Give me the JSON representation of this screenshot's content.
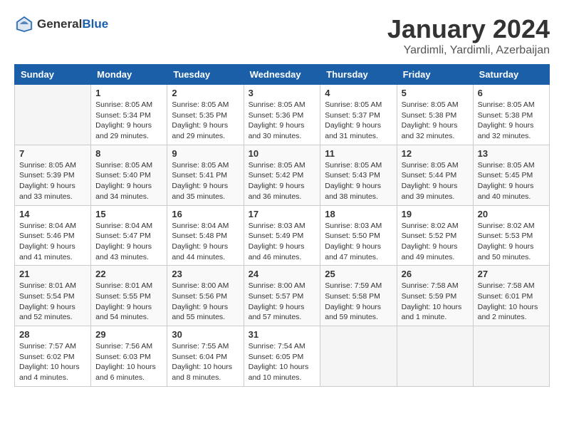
{
  "header": {
    "logo_general": "General",
    "logo_blue": "Blue",
    "month": "January 2024",
    "location": "Yardimli, Yardimli, Azerbaijan"
  },
  "weekdays": [
    "Sunday",
    "Monday",
    "Tuesday",
    "Wednesday",
    "Thursday",
    "Friday",
    "Saturday"
  ],
  "weeks": [
    [
      {
        "day": "",
        "info": ""
      },
      {
        "day": "1",
        "info": "Sunrise: 8:05 AM\nSunset: 5:34 PM\nDaylight: 9 hours\nand 29 minutes."
      },
      {
        "day": "2",
        "info": "Sunrise: 8:05 AM\nSunset: 5:35 PM\nDaylight: 9 hours\nand 29 minutes."
      },
      {
        "day": "3",
        "info": "Sunrise: 8:05 AM\nSunset: 5:36 PM\nDaylight: 9 hours\nand 30 minutes."
      },
      {
        "day": "4",
        "info": "Sunrise: 8:05 AM\nSunset: 5:37 PM\nDaylight: 9 hours\nand 31 minutes."
      },
      {
        "day": "5",
        "info": "Sunrise: 8:05 AM\nSunset: 5:38 PM\nDaylight: 9 hours\nand 32 minutes."
      },
      {
        "day": "6",
        "info": "Sunrise: 8:05 AM\nSunset: 5:38 PM\nDaylight: 9 hours\nand 32 minutes."
      }
    ],
    [
      {
        "day": "7",
        "info": "Sunrise: 8:05 AM\nSunset: 5:39 PM\nDaylight: 9 hours\nand 33 minutes."
      },
      {
        "day": "8",
        "info": "Sunrise: 8:05 AM\nSunset: 5:40 PM\nDaylight: 9 hours\nand 34 minutes."
      },
      {
        "day": "9",
        "info": "Sunrise: 8:05 AM\nSunset: 5:41 PM\nDaylight: 9 hours\nand 35 minutes."
      },
      {
        "day": "10",
        "info": "Sunrise: 8:05 AM\nSunset: 5:42 PM\nDaylight: 9 hours\nand 36 minutes."
      },
      {
        "day": "11",
        "info": "Sunrise: 8:05 AM\nSunset: 5:43 PM\nDaylight: 9 hours\nand 38 minutes."
      },
      {
        "day": "12",
        "info": "Sunrise: 8:05 AM\nSunset: 5:44 PM\nDaylight: 9 hours\nand 39 minutes."
      },
      {
        "day": "13",
        "info": "Sunrise: 8:05 AM\nSunset: 5:45 PM\nDaylight: 9 hours\nand 40 minutes."
      }
    ],
    [
      {
        "day": "14",
        "info": "Sunrise: 8:04 AM\nSunset: 5:46 PM\nDaylight: 9 hours\nand 41 minutes."
      },
      {
        "day": "15",
        "info": "Sunrise: 8:04 AM\nSunset: 5:47 PM\nDaylight: 9 hours\nand 43 minutes."
      },
      {
        "day": "16",
        "info": "Sunrise: 8:04 AM\nSunset: 5:48 PM\nDaylight: 9 hours\nand 44 minutes."
      },
      {
        "day": "17",
        "info": "Sunrise: 8:03 AM\nSunset: 5:49 PM\nDaylight: 9 hours\nand 46 minutes."
      },
      {
        "day": "18",
        "info": "Sunrise: 8:03 AM\nSunset: 5:50 PM\nDaylight: 9 hours\nand 47 minutes."
      },
      {
        "day": "19",
        "info": "Sunrise: 8:02 AM\nSunset: 5:52 PM\nDaylight: 9 hours\nand 49 minutes."
      },
      {
        "day": "20",
        "info": "Sunrise: 8:02 AM\nSunset: 5:53 PM\nDaylight: 9 hours\nand 50 minutes."
      }
    ],
    [
      {
        "day": "21",
        "info": "Sunrise: 8:01 AM\nSunset: 5:54 PM\nDaylight: 9 hours\nand 52 minutes."
      },
      {
        "day": "22",
        "info": "Sunrise: 8:01 AM\nSunset: 5:55 PM\nDaylight: 9 hours\nand 54 minutes."
      },
      {
        "day": "23",
        "info": "Sunrise: 8:00 AM\nSunset: 5:56 PM\nDaylight: 9 hours\nand 55 minutes."
      },
      {
        "day": "24",
        "info": "Sunrise: 8:00 AM\nSunset: 5:57 PM\nDaylight: 9 hours\nand 57 minutes."
      },
      {
        "day": "25",
        "info": "Sunrise: 7:59 AM\nSunset: 5:58 PM\nDaylight: 9 hours\nand 59 minutes."
      },
      {
        "day": "26",
        "info": "Sunrise: 7:58 AM\nSunset: 5:59 PM\nDaylight: 10 hours\nand 1 minute."
      },
      {
        "day": "27",
        "info": "Sunrise: 7:58 AM\nSunset: 6:01 PM\nDaylight: 10 hours\nand 2 minutes."
      }
    ],
    [
      {
        "day": "28",
        "info": "Sunrise: 7:57 AM\nSunset: 6:02 PM\nDaylight: 10 hours\nand 4 minutes."
      },
      {
        "day": "29",
        "info": "Sunrise: 7:56 AM\nSunset: 6:03 PM\nDaylight: 10 hours\nand 6 minutes."
      },
      {
        "day": "30",
        "info": "Sunrise: 7:55 AM\nSunset: 6:04 PM\nDaylight: 10 hours\nand 8 minutes."
      },
      {
        "day": "31",
        "info": "Sunrise: 7:54 AM\nSunset: 6:05 PM\nDaylight: 10 hours\nand 10 minutes."
      },
      {
        "day": "",
        "info": ""
      },
      {
        "day": "",
        "info": ""
      },
      {
        "day": "",
        "info": ""
      }
    ]
  ]
}
